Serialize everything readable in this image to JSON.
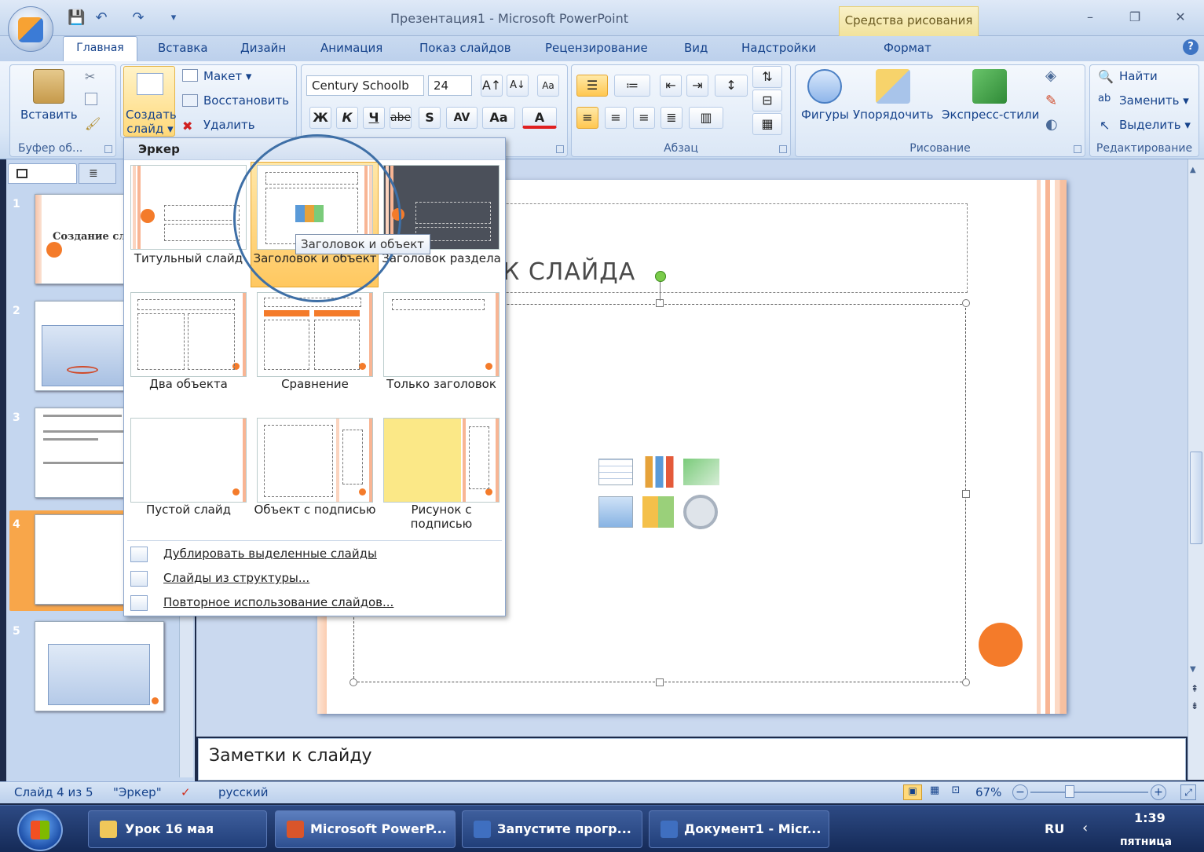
{
  "window": {
    "title": "Презентация1 - Microsoft PowerPoint",
    "context_tab": "Средства рисования",
    "min": "–",
    "max": "❐",
    "close": "✕"
  },
  "tabs": [
    "Главная",
    "Вставка",
    "Дизайн",
    "Анимация",
    "Показ слайдов",
    "Рецензирование",
    "Вид",
    "Надстройки",
    "Формат"
  ],
  "clipboard": {
    "paste": "Вставить",
    "label": "Буфер об..."
  },
  "slides_group": {
    "new_slide_line1": "Создать",
    "new_slide_line2": "слайд ▾",
    "layout": "Макет ▾",
    "reset": "Восстановить",
    "delete": "Удалить"
  },
  "font": {
    "name": "Century Schoolb",
    "size": "24",
    "bold": "Ж",
    "italic": "К",
    "underline": "Ч",
    "strike": "abe",
    "shadow": "S",
    "spacing": "AV",
    "case": "Aa",
    "color": "A"
  },
  "paragraph": {
    "label": "Абзац"
  },
  "drawing": {
    "shapes": "Фигуры",
    "arrange": "Упорядочить",
    "styles": "Экспресс-стили",
    "label": "Рисование"
  },
  "editing": {
    "find": "Найти",
    "replace": "Заменить ▾",
    "select": "Выделить ▾",
    "label": "Редактирование"
  },
  "gallery": {
    "header": "Эркер",
    "layouts": [
      {
        "label": "Титульный слайд"
      },
      {
        "label": "Заголовок и объект"
      },
      {
        "label": "Заголовок раздела"
      },
      {
        "label": "Два объекта"
      },
      {
        "label": "Сравнение"
      },
      {
        "label": "Только заголовок"
      },
      {
        "label": "Пустой слайд"
      },
      {
        "label": "Объект с подписью"
      },
      {
        "label": "Рисунок с подписью"
      }
    ],
    "menu": [
      "Дублировать выделенные слайды",
      "Слайды из структуры...",
      "Повторное использование слайдов..."
    ],
    "tooltip": "Заголовок и объект"
  },
  "thumbnails": [
    {
      "num": "1",
      "title": "Создание слайд-фи..."
    },
    {
      "num": "2",
      "title": ""
    },
    {
      "num": "3",
      "title": ""
    },
    {
      "num": "4",
      "title": ""
    },
    {
      "num": "5",
      "title": ""
    }
  ],
  "slide": {
    "title_partial": "К СЛАЙДА"
  },
  "notes": {
    "placeholder": "Заметки к слайду"
  },
  "status": {
    "slide": "Слайд 4 из 5",
    "theme": "\"Эркер\"",
    "lang": "русский",
    "zoom": "67%"
  },
  "taskbar": {
    "items": [
      "Урок 16 мая",
      "Microsoft PowerP...",
      "Запустите прогр...",
      "Документ1 - Micr..."
    ],
    "lang": "RU",
    "time": "1:39",
    "day": "пятница"
  },
  "colors": {
    "accent": "#f47b2a",
    "ribbon": "#dce8f7",
    "taskbar": "#1d3670"
  }
}
